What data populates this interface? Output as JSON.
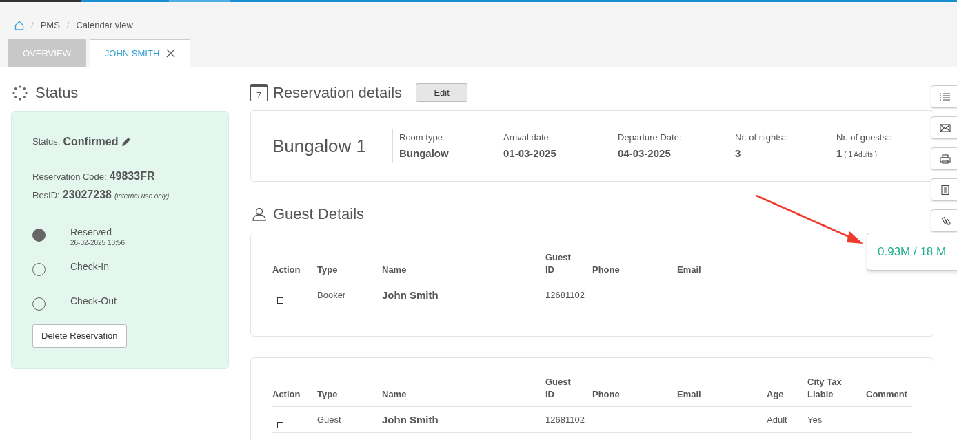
{
  "breadcrumb": [
    {
      "separator": "/",
      "label": "PMS"
    },
    {
      "separator": "/",
      "label": "Calendar view"
    }
  ],
  "tabs": [
    {
      "label": "OVERVIEW",
      "selected": false,
      "closable": false
    },
    {
      "label": "JOHN SMITH",
      "selected": true,
      "closable": true
    }
  ],
  "status_panel": {
    "title": "Status",
    "status_label": "Status:",
    "status": "Confirmed",
    "code_label": "Reservation Code:",
    "code": "49833FR",
    "resid_label": "ResID:",
    "resid": "23027238",
    "resid_note": "(internal use only)",
    "timeline": [
      {
        "label": "Reserved",
        "time": "26-02-2025 10:56",
        "done": true
      },
      {
        "label": "Check-In",
        "done": false
      },
      {
        "label": "Check-Out",
        "done": false
      }
    ],
    "delete_button": "Delete Reservation"
  },
  "reservation": {
    "title": "Reservation details",
    "edit_button": "Edit",
    "calendar_day": "7",
    "room": "Bungalow 1",
    "fields": [
      {
        "label": "Room type",
        "value": "Bungalow"
      },
      {
        "label": "Arrival date:",
        "value": "01-03-2025"
      },
      {
        "label": "Departure Date:",
        "value": "04-03-2025"
      },
      {
        "label": "Nr. of nights::",
        "value": "3"
      },
      {
        "label": "Nr. of guests::",
        "value": "1",
        "note": "( 1 Adults )"
      }
    ]
  },
  "guest_details": {
    "title": "Guest Details",
    "tables": [
      {
        "columns": [
          "Action",
          "Type",
          "Name",
          "Guest ID",
          "Phone",
          "Email"
        ],
        "rows": [
          {
            "checked": false,
            "type": "Booker",
            "name": "John Smith",
            "guest_id": "12681102"
          }
        ]
      },
      {
        "columns": [
          "Action",
          "Type",
          "Name",
          "Guest ID",
          "Phone",
          "Email",
          "Age",
          "City Tax Liable",
          "Comment"
        ],
        "rows": [
          {
            "checked": false,
            "type": "Guest",
            "name": "John Smith",
            "guest_id": "12681102",
            "age": "Adult",
            "city_tax_liable": "Yes"
          }
        ]
      }
    ]
  },
  "memory_popup": "0.93M / 18 M"
}
